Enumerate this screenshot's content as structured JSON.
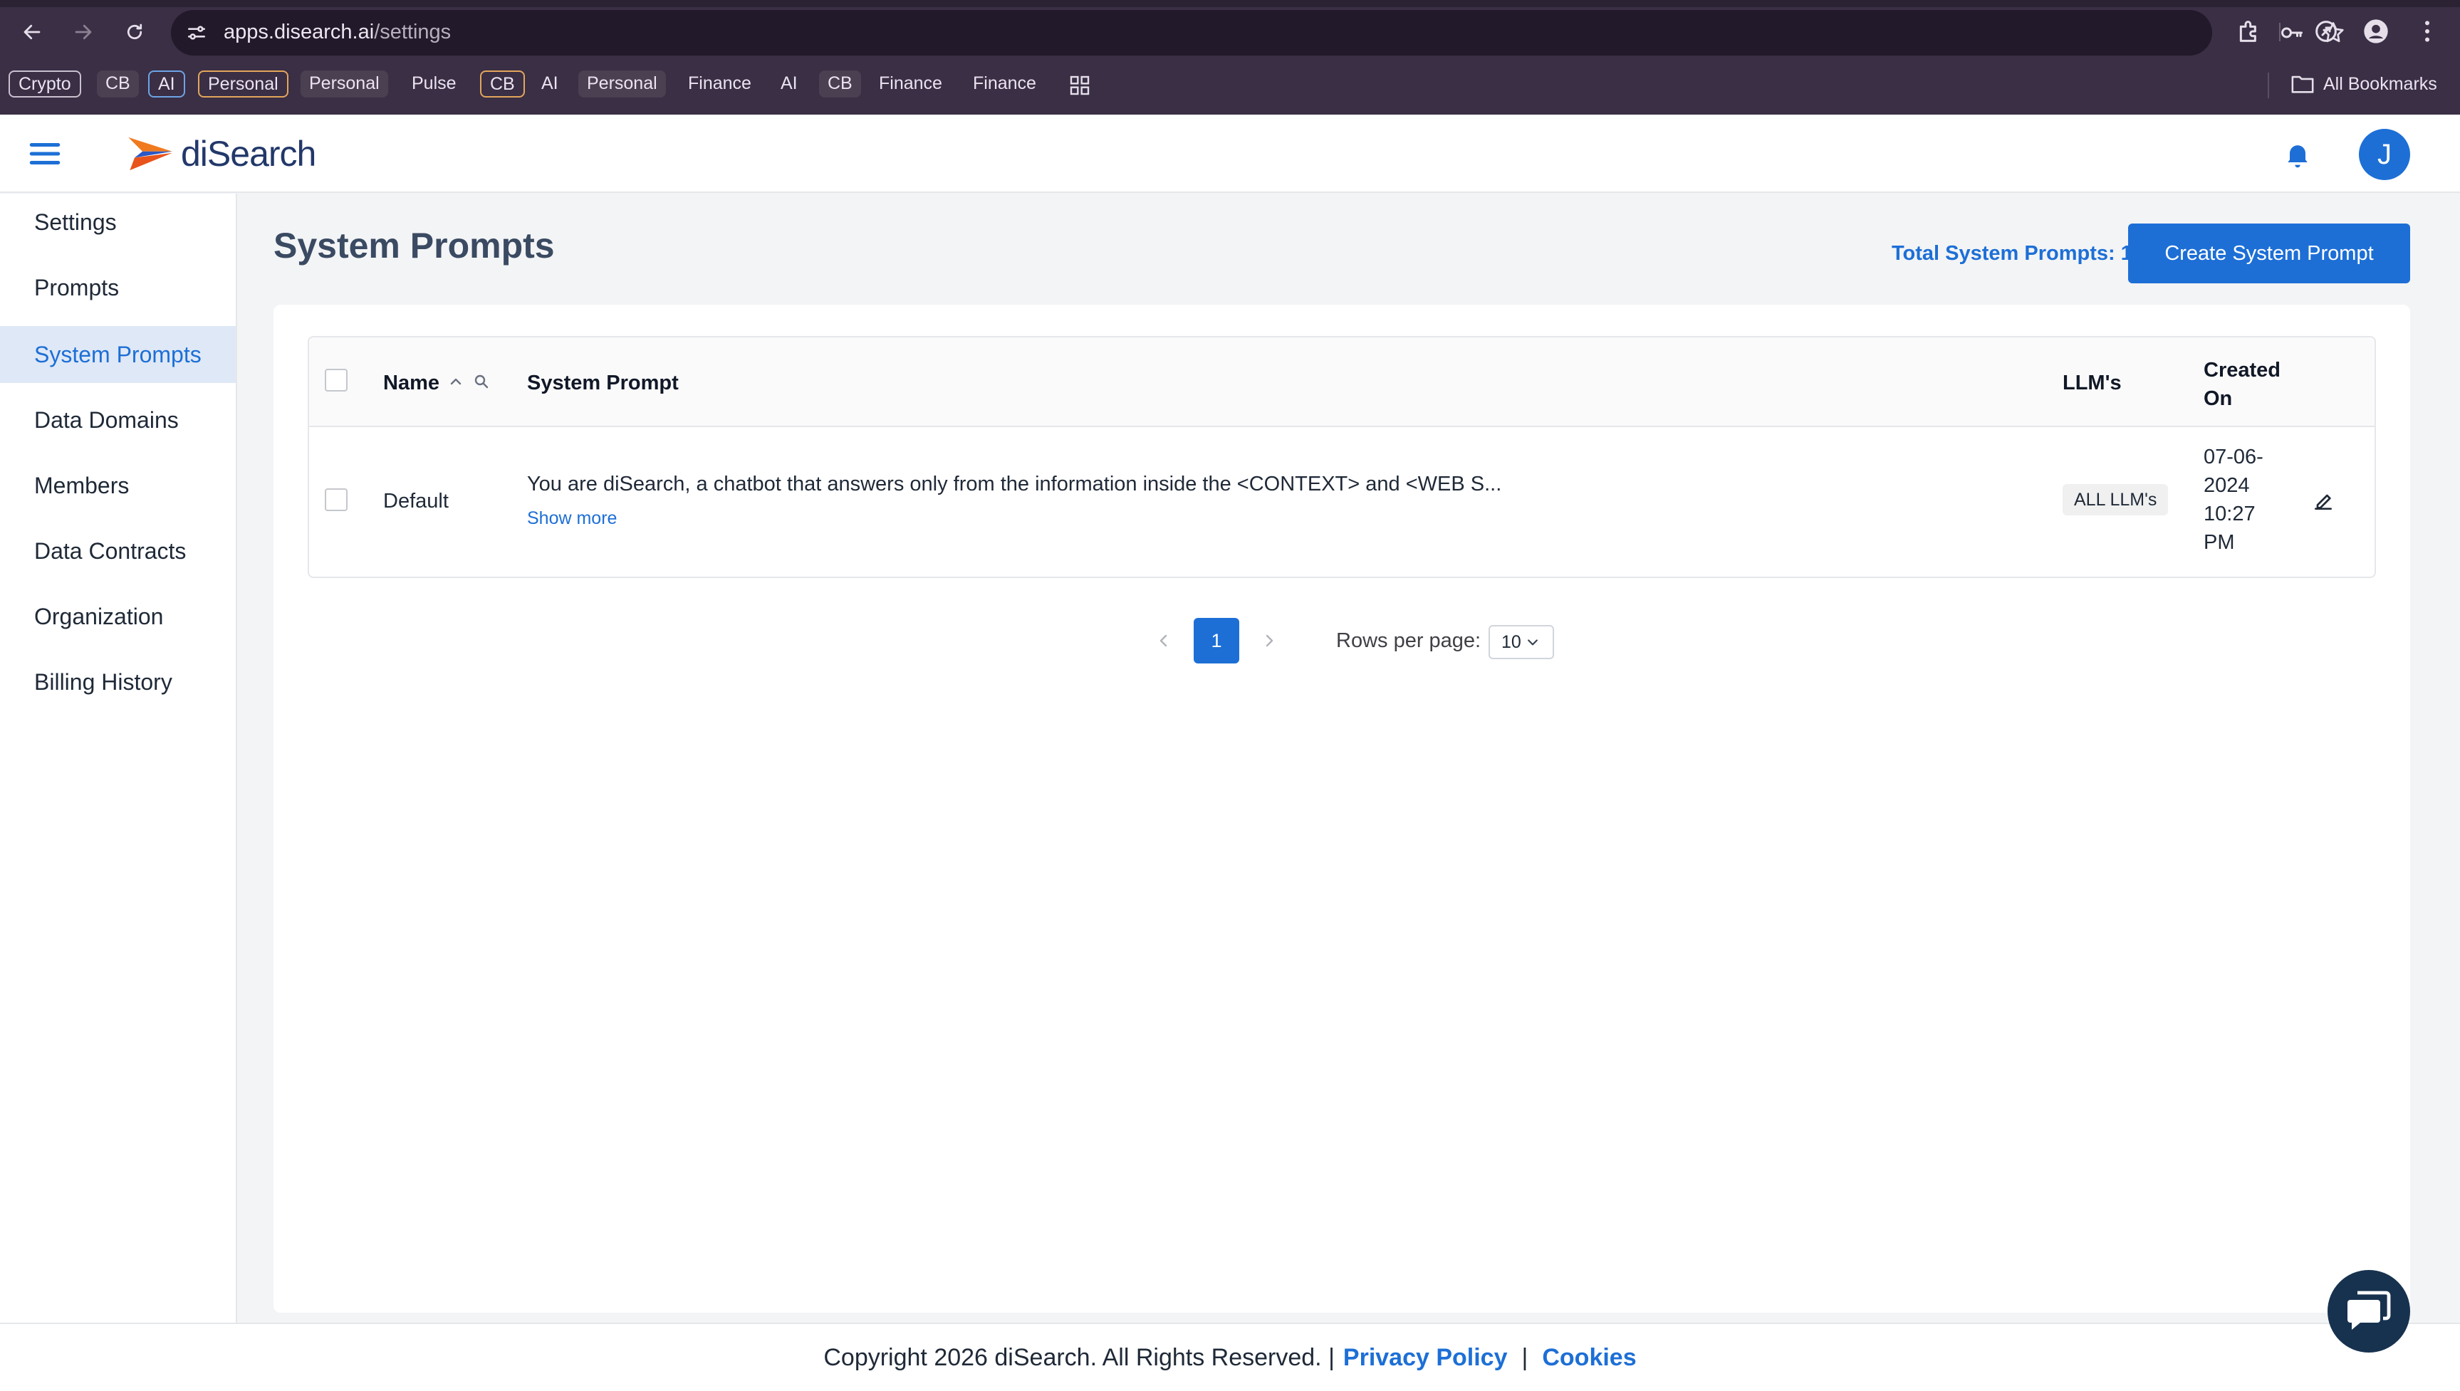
{
  "browser": {
    "url_host": "apps.disearch.ai",
    "url_path": "/settings",
    "bookmarks": [
      "Crypto",
      "CB",
      "AI",
      "Personal",
      "Personal",
      "Pulse",
      "CB",
      "AI",
      "Personal",
      "Finance",
      "AI",
      "CB",
      "Finance",
      "Finance"
    ],
    "all_bookmarks": "All Bookmarks"
  },
  "header": {
    "logo_text": "diSearch",
    "avatar_initial": "J"
  },
  "sidebar": {
    "items": [
      {
        "label": "Settings"
      },
      {
        "label": "Prompts"
      },
      {
        "label": "System Prompts"
      },
      {
        "label": "Data Domains"
      },
      {
        "label": "Members"
      },
      {
        "label": "Data Contracts"
      },
      {
        "label": "Organization"
      },
      {
        "label": "Billing History"
      }
    ],
    "active_index": 2
  },
  "main": {
    "title": "System Prompts",
    "total_label": "Total System Prompts: 1",
    "create_button": "Create System Prompt",
    "table": {
      "columns": [
        "Name",
        "System Prompt",
        "LLM's",
        "Created On"
      ],
      "rows": [
        {
          "name": "Default",
          "prompt": "You are diSearch, a chatbot that answers only from the information inside the <CONTEXT> and <WEB S...",
          "show_more": "Show more",
          "llms": "ALL LLM's",
          "created_on": "07-06-2024 10:27 PM"
        }
      ]
    },
    "pagination": {
      "current_page": "1",
      "rows_label": "Rows per page:",
      "rows_value": "10"
    }
  },
  "footer": {
    "copyright": "Copyright 2026 diSearch. All Rights Reserved. |",
    "privacy": "Privacy Policy",
    "separator": "|",
    "cookies": "Cookies"
  },
  "colors": {
    "accent": "#1d6fd6",
    "chrome": "#3a2f45",
    "active_bg": "#dfe8f6"
  }
}
